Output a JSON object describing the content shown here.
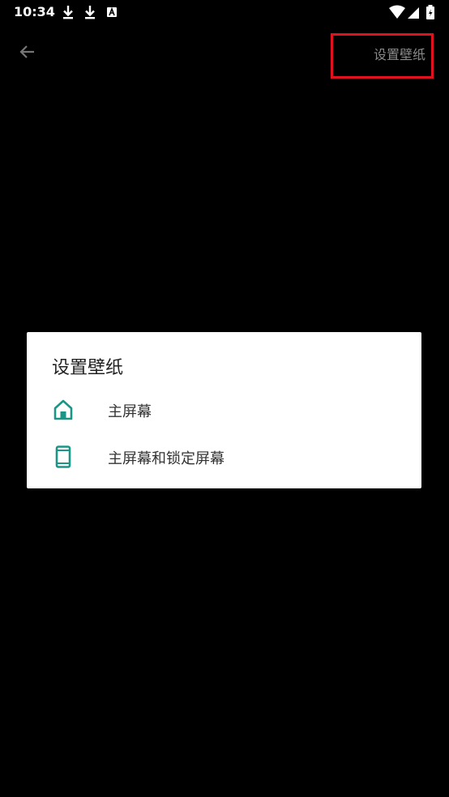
{
  "status_bar": {
    "time": "10:34",
    "icons": [
      "download-icon",
      "download-icon",
      "a-notification-icon",
      "wifi-icon",
      "cellular-signal-icon",
      "battery-icon"
    ]
  },
  "app_bar": {
    "back_icon": "arrow-left-icon",
    "action_label": "设置壁纸",
    "highlight_color": "#e0121f"
  },
  "dialog": {
    "title": "设置壁纸",
    "accent_color": "#1b9686",
    "options": [
      {
        "label": "主屏幕",
        "icon": "home-icon"
      },
      {
        "label": "主屏幕和锁定屏幕",
        "icon": "phone-icon"
      }
    ]
  }
}
